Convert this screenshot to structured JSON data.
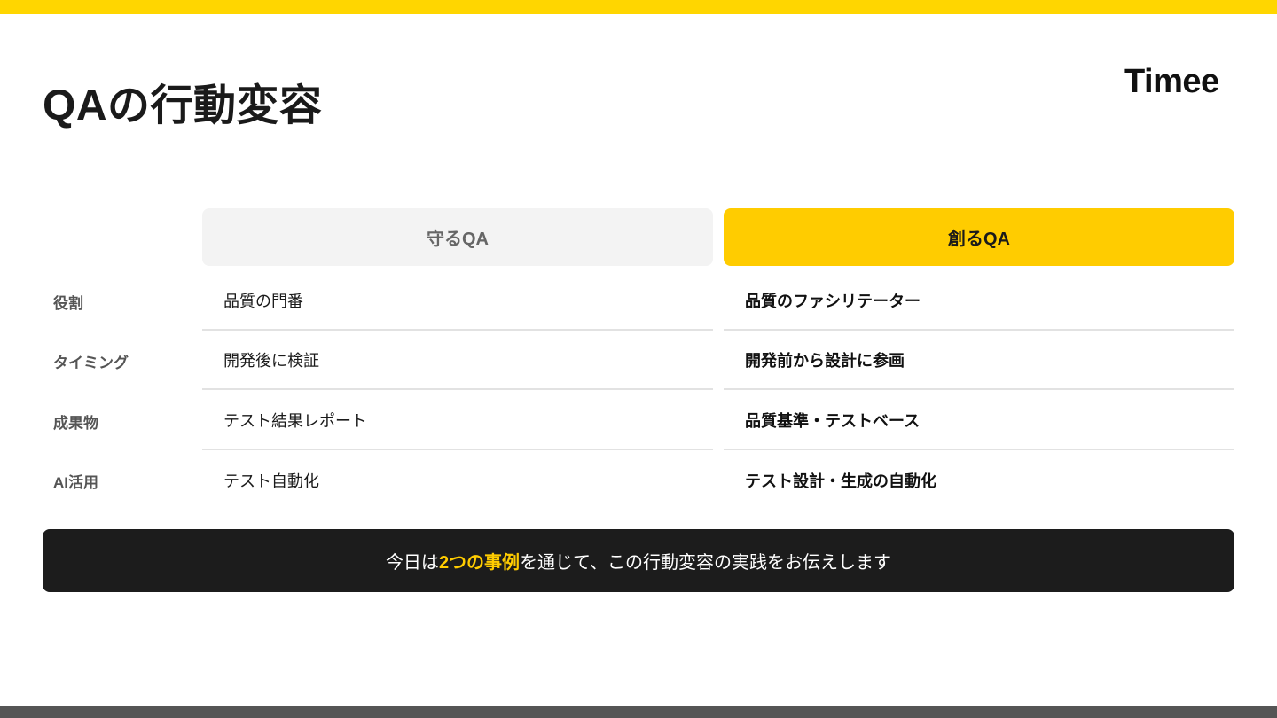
{
  "slide": {
    "title": "QAの行動変容",
    "logo_text": "Timee"
  },
  "columns": {
    "mamoru": "守るQA",
    "tsukuru": "創るQA"
  },
  "rows": [
    {
      "label": "役割",
      "mamoru": "品質の門番",
      "tsukuru": "品質のファシリテーター"
    },
    {
      "label": "タイミング",
      "mamoru": "開発後に検証",
      "tsukuru": "開発前から設計に参画"
    },
    {
      "label": "成果物",
      "mamoru": "テスト結果レポート",
      "tsukuru": "品質基準・テストベース"
    },
    {
      "label": "AI活用",
      "mamoru": "テスト自動化",
      "tsukuru": "テスト設計・生成の自動化"
    }
  ],
  "banner": {
    "prefix": "今日は",
    "highlight": "2つの事例",
    "suffix": "を通じて、この行動変容の実践をお伝えします"
  },
  "colors": {
    "accent_yellow": "#FFCC00",
    "top_bar": "#FFD600",
    "banner_bg": "#1C1C1C",
    "mamoru_header_bg": "#F3F3F3",
    "bottom_bar": "#555555"
  }
}
